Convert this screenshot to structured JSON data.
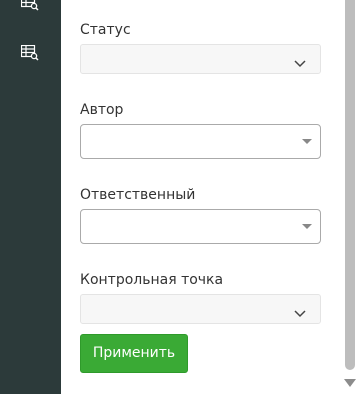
{
  "sidebar": {
    "icons": [
      {
        "name": "table-search-icon"
      },
      {
        "name": "table-search-icon"
      }
    ]
  },
  "filters": {
    "status_label": "Статус",
    "author_label": "Автор",
    "responsible_label": "Ответственный",
    "milestone_label": "Контрольная точка"
  },
  "apply_button": {
    "label": "Применить"
  },
  "colors": {
    "sidebar": "#2c3a3a",
    "accent_button": "#3aaa35"
  }
}
